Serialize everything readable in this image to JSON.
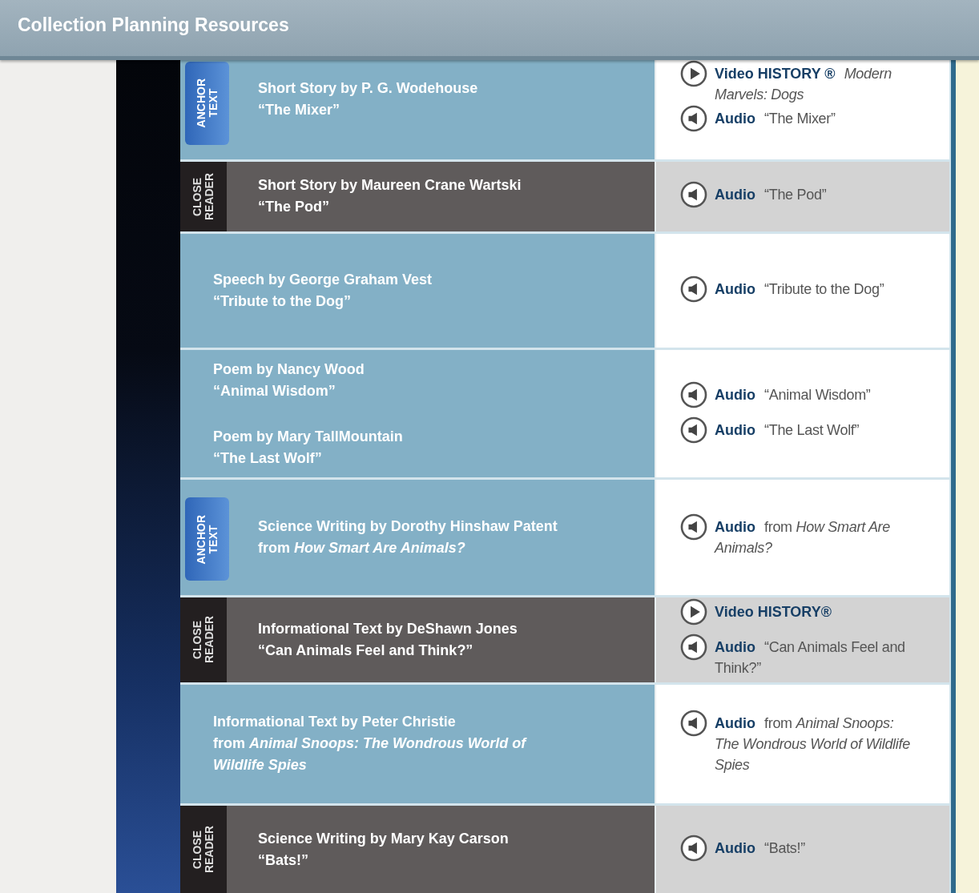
{
  "header": {
    "title": "Collection Planning Resources"
  },
  "rows": [
    {
      "badge": {
        "kind": "anchor",
        "label": "ANCHOR TEXT"
      },
      "selections": [
        {
          "heading": "Short Story by P. G. Wodehouse",
          "title": "“The Mixer”"
        }
      ],
      "media": [
        {
          "kind": "video",
          "label": "Video HISTORY ®",
          "detail": "*Modern Marvels: Dogs*"
        },
        {
          "kind": "audio",
          "label": "Audio",
          "detail": "“The Mixer”"
        }
      ]
    },
    {
      "badge": {
        "kind": "close",
        "label": "CLOSE READER"
      },
      "selections": [
        {
          "heading": "Short Story by Maureen Crane Wartski",
          "title": "“The Pod”"
        }
      ],
      "media": [
        {
          "kind": "audio",
          "label": "Audio",
          "detail": "“The Pod”"
        }
      ]
    },
    {
      "selections": [
        {
          "heading": "Speech by George Graham Vest",
          "title": "“Tribute to the Dog”"
        }
      ],
      "media": [
        {
          "kind": "audio",
          "label": "Audio",
          "detail": "“Tribute to the Dog”"
        }
      ]
    },
    {
      "selections": [
        {
          "heading": "Poem by Nancy Wood",
          "title": "“Animal Wisdom”"
        },
        {
          "heading": "Poem by Mary TallMountain",
          "title": "“The Last Wolf”"
        }
      ],
      "media": [
        {
          "kind": "audio",
          "label": "Audio",
          "detail": "“Animal Wisdom”"
        },
        {
          "kind": "audio",
          "label": "Audio",
          "detail": "“The Last Wolf”"
        }
      ]
    },
    {
      "badge": {
        "kind": "anchor",
        "label": "ANCHOR TEXT"
      },
      "selections": [
        {
          "heading": "Science Writing by Dorothy Hinshaw Patent",
          "title": "from *How Smart Are Animals?*"
        }
      ],
      "media": [
        {
          "kind": "audio",
          "label": "Audio",
          "detail": "from *How Smart Are Animals?*"
        }
      ]
    },
    {
      "badge": {
        "kind": "close",
        "label": "CLOSE READER"
      },
      "selections": [
        {
          "heading": "Informational Text by DeShawn Jones",
          "title": "“Can Animals Feel and Think?”"
        }
      ],
      "media": [
        {
          "kind": "video",
          "label": "Video HISTORY®"
        },
        {
          "kind": "audio",
          "label": "Audio",
          "detail": "“Can Animals Feel and Think?”"
        }
      ]
    },
    {
      "selections": [
        {
          "heading": "Informational Text by Peter Christie",
          "title": "from *Animal Snoops: The Wondrous World of Wildlife Spies*"
        }
      ],
      "media": [
        {
          "kind": "audio",
          "label": "Audio",
          "detail": "from *Animal Snoops: The Wondrous World of Wildlife Spies*"
        }
      ]
    },
    {
      "badge": {
        "kind": "close",
        "label": "CLOSE READER"
      },
      "selections": [
        {
          "heading": "Science Writing by Mary Kay Carson",
          "title": "“Bats!”"
        }
      ],
      "media": [
        {
          "kind": "audio",
          "label": "Audio",
          "detail": "“Bats!”"
        }
      ]
    }
  ]
}
